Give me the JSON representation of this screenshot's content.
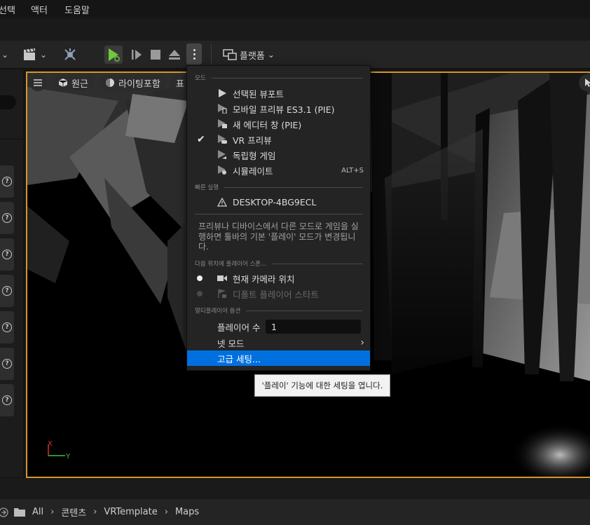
{
  "menubar": {
    "items": [
      "선택",
      "액터",
      "도움말"
    ]
  },
  "toolbar": {
    "platform_label": "플랫폼",
    "icons": [
      "chevron-down-icon",
      "clapperboard-icon",
      "blueprint-icon",
      "play-icon",
      "frame-advance-icon",
      "stop-icon",
      "eject-icon",
      "more-options-icon",
      "platform-icon"
    ]
  },
  "viewport": {
    "chips": {
      "perspective": "원근",
      "lighting": "라이팅포함",
      "show": "표"
    },
    "axis": {
      "x": "X",
      "y": "Y"
    }
  },
  "dropdown": {
    "section_modes": "모드",
    "modes": [
      {
        "label": "선택된 뷰포트",
        "icon": "play-icon",
        "checked": false,
        "shortcut": ""
      },
      {
        "label": "모바일 프리뷰 ES3.1 (PIE)",
        "icon": "mobile-preview-icon",
        "checked": false,
        "shortcut": ""
      },
      {
        "label": "새 에디터 창 (PIE)",
        "icon": "new-window-icon",
        "checked": false,
        "shortcut": ""
      },
      {
        "label": "VR 프리뷰",
        "icon": "vr-preview-icon",
        "checked": true,
        "shortcut": ""
      },
      {
        "label": "독립형 게임",
        "icon": "standalone-icon",
        "checked": false,
        "shortcut": ""
      },
      {
        "label": "시뮬레이트",
        "icon": "simulate-icon",
        "checked": false,
        "shortcut": "ALT+S"
      }
    ],
    "section_quick": "빠른 실행",
    "device": "DESKTOP-4BG9ECL",
    "description": "프리뷰나 디바이스에서 다른 모드로 게임을 실행하면 툴바의 기본 '플레이' 모드가 변경됩니다.",
    "section_spawn": "다음 위치에 플레이어 스폰...",
    "spawn": [
      {
        "label": "현재 카메라 위치",
        "selected": true,
        "enabled": true
      },
      {
        "label": "디폴트 플레이어 스타트",
        "selected": false,
        "enabled": false
      }
    ],
    "section_multi": "멀티플레이어 옵션",
    "player_count_label": "플레이어 수",
    "player_count_value": "1",
    "net_mode_label": "넷 모드",
    "advanced_label": "고급 세팅..."
  },
  "tooltip": "'플레이' 기능에 대한 세팅을 엽니다.",
  "path": {
    "items": [
      "All",
      "콘텐츠",
      "VRTemplate",
      "Maps"
    ]
  },
  "colors": {
    "accent": "#0070e0",
    "viewport_border": "#d8952a",
    "play_green": "#6fc93a"
  }
}
